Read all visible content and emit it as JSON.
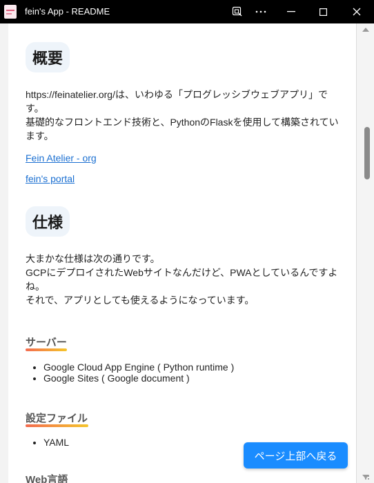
{
  "window": {
    "title": "fein's App - README"
  },
  "content": {
    "overview": {
      "heading": "概要",
      "para_line1": "https://feinatelier.org/は、いわゆる「プログレッシブウェブアプリ」で",
      "para_line2": "す。",
      "para_line3": "基礎的なフロントエンド技術と、PythonのFlaskを使用して構築されてい",
      "para_line4": "ます。",
      "link1": "Fein Atelier - org",
      "link2": "fein's portal"
    },
    "spec": {
      "heading": "仕様",
      "para_line1": "大まかな仕様は次の通りです。",
      "para_line2": "GCPにデプロイされたWebサイトなんだけど、PWAとしているんですよ",
      "para_line3": "ね。",
      "para_line4": "それで、アプリとしても使えるようになっています。"
    },
    "server": {
      "heading": "サーバー",
      "items": [
        "Google Cloud App Engine ( Python runtime )",
        "Google Sites ( Google document )"
      ]
    },
    "config": {
      "heading": "設定ファイル",
      "items": [
        "YAML"
      ]
    },
    "web_lang": {
      "heading": "Web言語"
    }
  },
  "back_to_top_label": "ページ上部へ戻る"
}
